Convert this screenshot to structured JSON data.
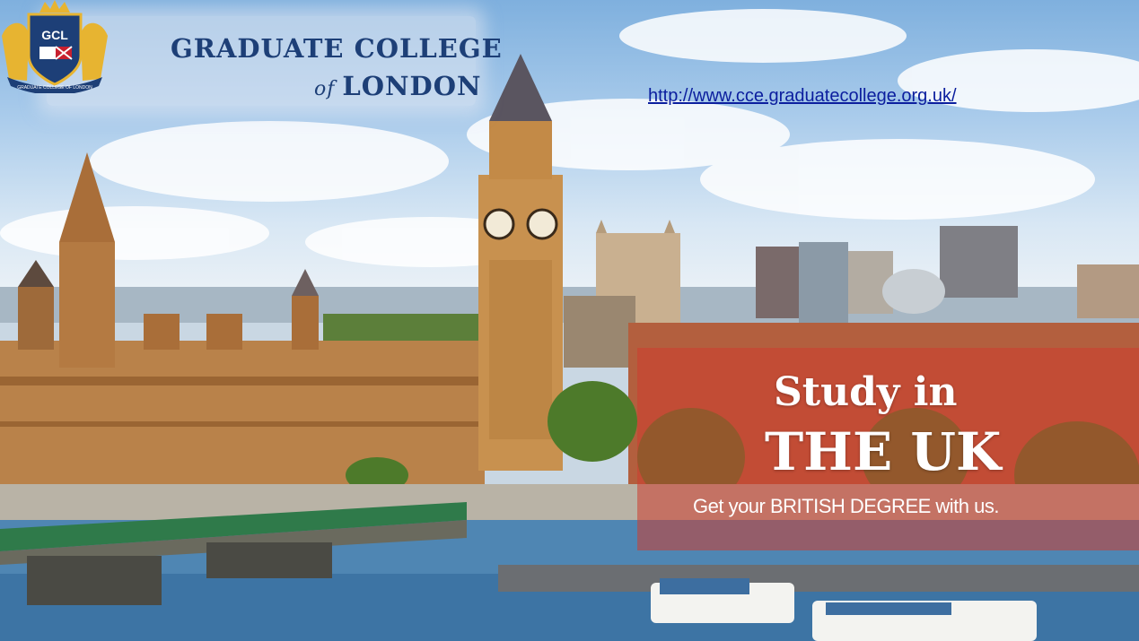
{
  "header": {
    "crest_initials": "GCL",
    "crest_ribbon": "GRADUATE COLLEGE OF LONDON",
    "college_name_line1": "GRADUATE COLLEGE",
    "college_name_of": "of",
    "college_name_line2": "LONDON",
    "website_link": "http://www.cce.graduatecollege.org.uk/"
  },
  "promo": {
    "line1": "Study in",
    "line2": "THE UK",
    "tagline": "Get your BRITISH DEGREE with us."
  },
  "colors": {
    "brand_navy": "#1d3f77",
    "link_blue": "#0b1e9e",
    "promo_red": "#cd3c2d",
    "stone_gold": "#c8914f"
  },
  "background_icon": "london-westminster-photo"
}
